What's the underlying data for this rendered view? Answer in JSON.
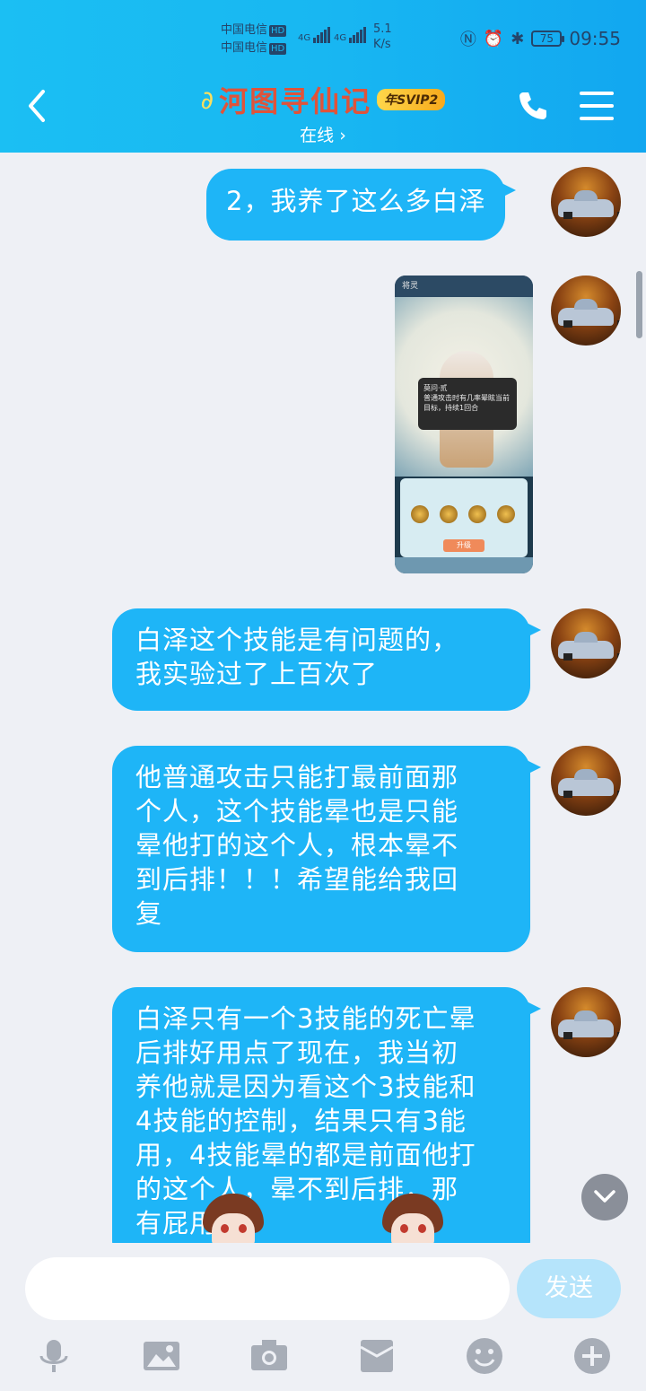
{
  "status_bar": {
    "carrier_line1": "中国电信",
    "carrier_line2": "中国电信",
    "hd": "HD",
    "network_1": "4G",
    "network_2": "4G",
    "speed_value": "5.1",
    "speed_unit": "K/s",
    "battery": "75",
    "time": "09:55"
  },
  "header": {
    "title": "河图寻仙记",
    "badge": "年SVIP2",
    "subtitle": "在线 ›"
  },
  "messages": [
    {
      "type": "text",
      "text": "2，我养了这么多白泽"
    },
    {
      "type": "image",
      "shot_title": "将灵",
      "shot_popup_title": "莫问·贰",
      "shot_popup_text": "普通攻击时有几率晕眩当前目标，持续1回合",
      "shot_button": "升级"
    },
    {
      "type": "text",
      "lines": [
        "白泽这个技能是有问题的，",
        "我实验过了上百次了"
      ]
    },
    {
      "type": "text",
      "lines": [
        "他普通攻击只能打最前面那",
        "个人，这个技能晕也是只能",
        "晕他打的这个人，根本晕不",
        "到后排！！！希望能给我回",
        "复"
      ]
    },
    {
      "type": "text",
      "lines": [
        "白泽只有一个3技能的死亡晕",
        "后排好用点了现在，我当初",
        "养他就是因为看这个3技能和",
        "4技能的控制，结果只有3能",
        "用，4技能晕的都是前面他打",
        "的这个人，晕不到后排，那",
        "有屁用"
      ]
    }
  ],
  "input": {
    "placeholder": "",
    "send_label": "发送"
  },
  "toolbar": [
    "microphone-icon",
    "image-icon",
    "camera-icon",
    "red-packet-icon",
    "emoji-icon",
    "plus-icon"
  ],
  "colors": {
    "header_gradient_start": "#1bbff3",
    "bubble": "#1eb5f7",
    "title_text": "#e0533a",
    "send_disabled": "#b5e4fb"
  }
}
